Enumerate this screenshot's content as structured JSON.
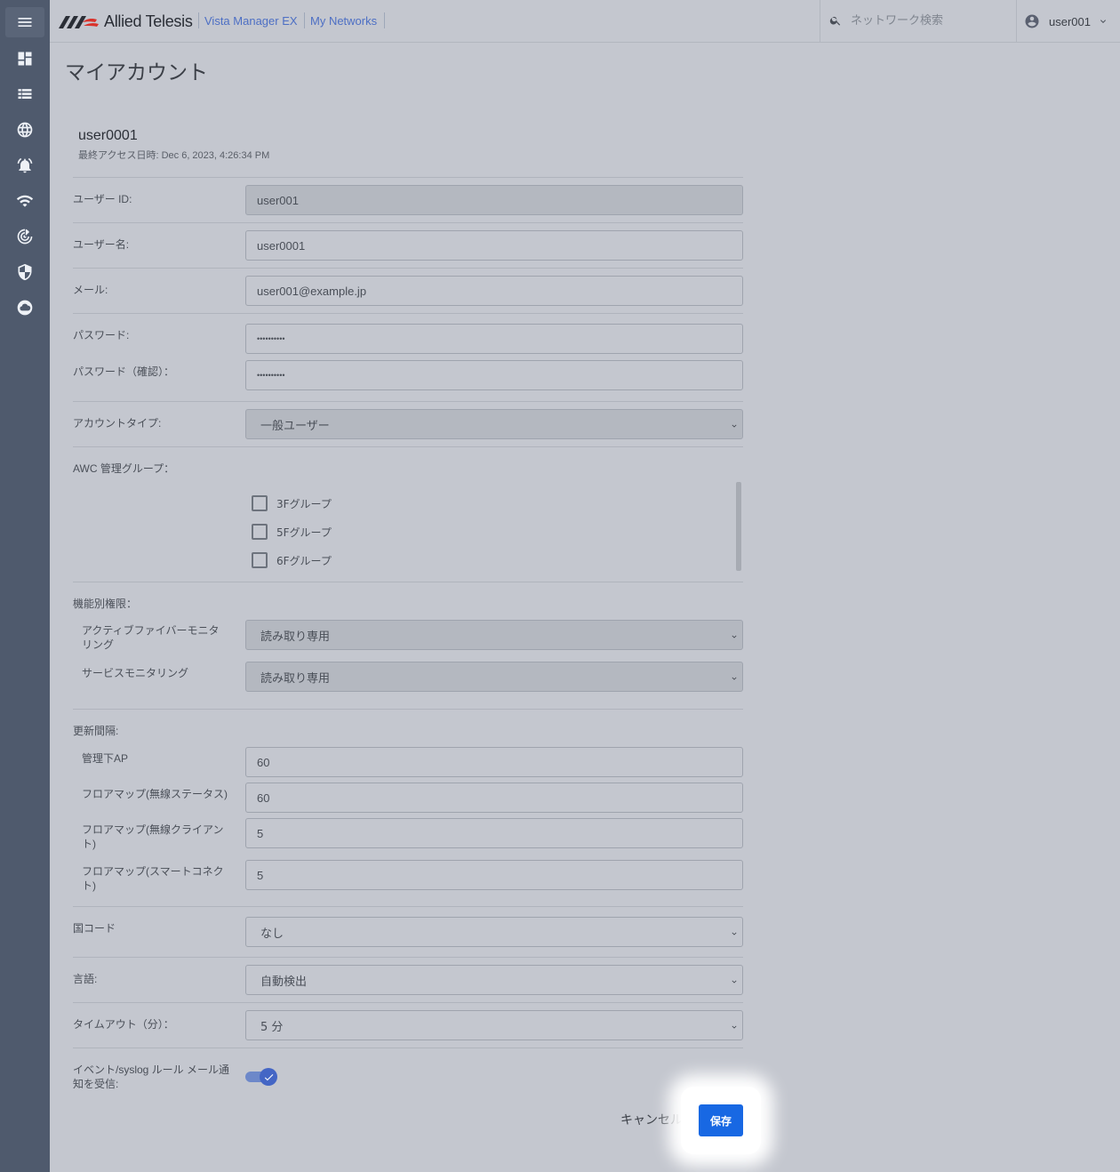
{
  "header": {
    "brand": "Allied Telesis",
    "breadcrumbs": [
      "Vista Manager EX",
      "My Networks"
    ],
    "search_placeholder": "ネットワーク検索",
    "user": "user001"
  },
  "sidebar": {
    "items": [
      "menu-icon",
      "dashboard-icon",
      "list-icon",
      "globe-icon",
      "alarm-icon",
      "wifi-icon",
      "radar-icon",
      "shield-icon",
      "cloud-icon"
    ]
  },
  "page": {
    "title": "マイアカウント",
    "account_name": "user0001",
    "last_access_label": "最終アクセス日時:",
    "last_access_value": "Dec 6, 2023, 4:26:34 PM"
  },
  "form": {
    "user_id_label": "ユーザー ID:",
    "user_id_value": "user001",
    "username_label": "ユーザー名:",
    "username_value": "user0001",
    "email_label": "メール:",
    "email_value": "user001@example.jp",
    "password_label": "パスワード:",
    "password_value": "••••••••••",
    "password_confirm_label": "パスワード（確認）：",
    "password_confirm_value": "••••••••••",
    "account_type_label": "アカウントタイプ:",
    "account_type_value": "一般ユーザー",
    "awc_group_label": "AWC 管理グループ：",
    "awc_groups": [
      "3Fグループ",
      "5Fグループ",
      "6Fグループ"
    ],
    "feature_perm_label": "機能別権限：",
    "active_fiber_label_1": "アクティブファイバーモニタ",
    "active_fiber_label_2": "リング",
    "active_fiber_value": "読み取り専用",
    "service_mon_label": "サービスモニタリング",
    "service_mon_value": "読み取り専用",
    "refresh_label": "更新間隔:",
    "managed_ap_label": "管理下AP",
    "managed_ap_value": "60",
    "floor_wireless_status_label": "フロアマップ(無線ステータス)",
    "floor_wireless_status_value": "60",
    "floor_wireless_client_label_1": "フロアマップ(無線クライアン",
    "floor_wireless_client_label_2": "ト)",
    "floor_wireless_client_value": "5",
    "floor_smart_label_1": "フロアマップ(スマートコネク",
    "floor_smart_label_2": "ト)",
    "floor_smart_value": "5",
    "country_label": "国コード",
    "country_value": "なし",
    "language_label": "言語:",
    "language_value": "自動検出",
    "timeout_label": "タイムアウト（分）：",
    "timeout_value": "5 分",
    "event_mail_label_1": "イベント/syslog ルール メール通",
    "event_mail_label_2": "知を受信:",
    "event_mail_enabled": true
  },
  "actions": {
    "cancel": "キャンセル",
    "save": "保存"
  },
  "colors": {
    "sidebar": "#4f5a6d",
    "background": "#c4c7cf",
    "link": "#4d6fc4",
    "primary": "#1868e3"
  }
}
